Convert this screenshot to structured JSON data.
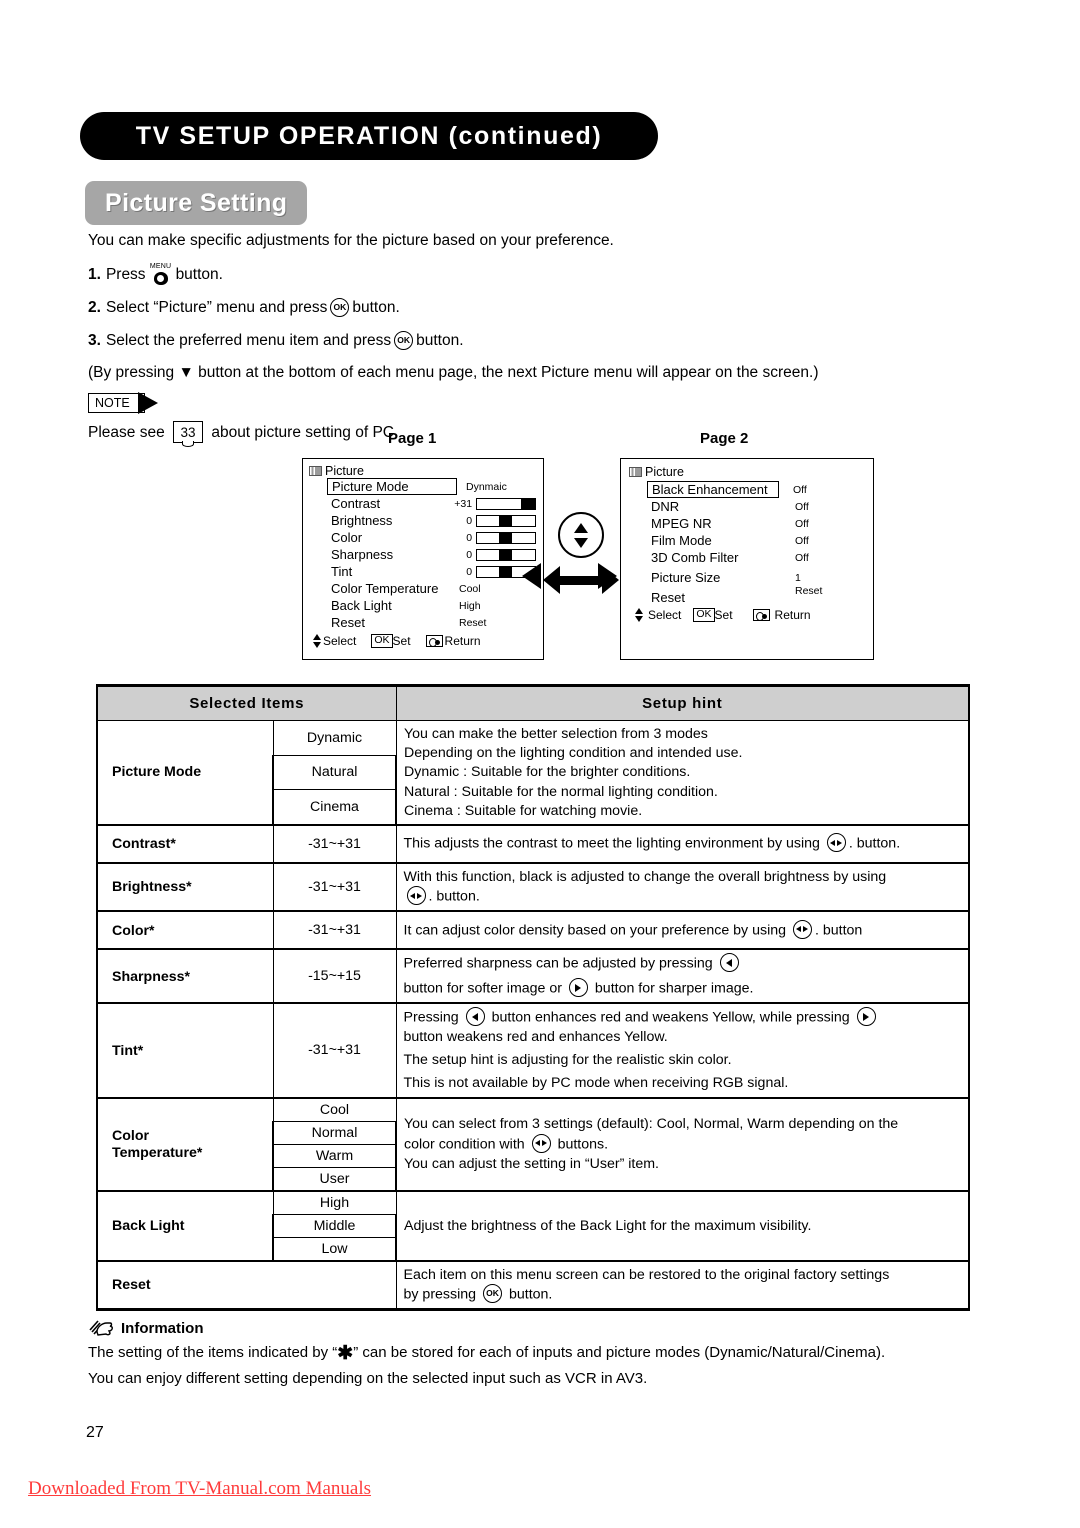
{
  "header": {
    "title": "TV SETUP OPERATION (continued)"
  },
  "section": {
    "title": "Picture Setting"
  },
  "intro": {
    "lead": "You can make specific adjustments for the picture based on your preference.",
    "steps": [
      {
        "num": "1.",
        "before": "Press",
        "icon": "menu-button",
        "after": "button."
      },
      {
        "num": "2.",
        "before": "Select “Picture” menu and press",
        "icon": "ok-button",
        "after": "button."
      },
      {
        "num": "3.",
        "before": "Select the preferred menu item and press",
        "icon": "ok-button",
        "after": "button."
      }
    ],
    "paren": "(By pressing ▼ button at the bottom of each menu page, the next Picture menu will appear on the screen.)",
    "note_badge": "NOTE",
    "note_before": "Please see",
    "note_page_ref": "33",
    "note_after": "about picture setting of PC"
  },
  "osd": {
    "page1": {
      "label": "Page 1",
      "menu_title": "Picture",
      "rows": [
        {
          "name": "Picture Mode",
          "value": "Dynmaic",
          "boxed": true,
          "bar": null
        },
        {
          "name": "Contrast",
          "value": "+31",
          "boxed": false,
          "bar": 100
        },
        {
          "name": "Brightness",
          "value": "0",
          "boxed": false,
          "bar": 50
        },
        {
          "name": "Color",
          "value": "0",
          "boxed": false,
          "bar": 50
        },
        {
          "name": "Sharpness",
          "value": "0",
          "boxed": false,
          "bar": 50
        },
        {
          "name": "Tint",
          "value": "0",
          "boxed": false,
          "bar": 50
        },
        {
          "name": "Color Temperature",
          "value": "Cool",
          "boxed": false,
          "bar": null
        },
        {
          "name": "Back Light",
          "value": "High",
          "boxed": false,
          "bar": null
        },
        {
          "name": "Reset",
          "value": "Reset",
          "boxed": false,
          "bar": null
        }
      ],
      "footer": {
        "select": "Select",
        "ok": "OK",
        "set": "Set",
        "return": "Return"
      }
    },
    "page2": {
      "label": "Page 2",
      "menu_title": "Picture",
      "rows": [
        {
          "name": "Black Enhancement",
          "value": "Off",
          "boxed": true
        },
        {
          "name": "DNR",
          "value": "Off",
          "boxed": false
        },
        {
          "name": "MPEG NR",
          "value": "Off",
          "boxed": false
        },
        {
          "name": "Film Mode",
          "value": "Off",
          "boxed": false
        },
        {
          "name": "3D Comb Filter",
          "value": "Off",
          "boxed": false
        },
        {
          "name": "Picture Size",
          "value": "1",
          "boxed": false
        },
        {
          "name": "Reset",
          "value": "Reset",
          "boxed": false
        }
      ],
      "footer": {
        "select": "Select",
        "ok": "OK",
        "set": "Set",
        "return": "Return"
      }
    }
  },
  "table": {
    "headers": {
      "items": "Selected Items",
      "hint": "Setup hint"
    },
    "rows": [
      {
        "item": "Picture Mode",
        "values": [
          "Dynamic",
          "Natural",
          "Cinema"
        ],
        "hint_lines": [
          "You can make the better selection from 3 modes",
          "Depending on the lighting condition and intended use.",
          "Dynamic : Suitable for the brighter conditions.",
          "Natural    : Suitable for the normal lighting condition.",
          "Cinema   : Suitable for watching movie."
        ]
      },
      {
        "item": "Contrast",
        "star": true,
        "values": [
          "-31~+31"
        ],
        "hint_parts": [
          "This adjusts the contrast to meet the lighting environment by using",
          "lr-button",
          ". button."
        ]
      },
      {
        "item": "Brightness",
        "star": true,
        "values": [
          "-31~+31"
        ],
        "hint_parts": [
          "With this function, black is adjusted to change the overall brightness by using",
          "lr-button",
          ". button."
        ]
      },
      {
        "item": "Color",
        "star": true,
        "values": [
          "-31~+31"
        ],
        "hint_parts": [
          "It can adjust color density based on your preference by using",
          "lr-button",
          ". button"
        ]
      },
      {
        "item": "Sharpness",
        "star": true,
        "values": [
          "-15~+15"
        ],
        "hint_parts_a": [
          "Preferred sharpness can be adjusted by pressing",
          "left-button",
          ""
        ],
        "hint_parts_b": [
          "button for softer image or",
          "right-button",
          "button for sharper image."
        ]
      },
      {
        "item": "Tint",
        "star": true,
        "values": [
          "-31~+31"
        ],
        "hint_parts_a": [
          "Pressing",
          "left-button",
          "button enhances red and weakens Yellow, while pressing",
          "right-button",
          ""
        ],
        "hint_b": "button weakens red and enhances Yellow.",
        "hint_c": "The setup hint is adjusting for the realistic skin color.",
        "hint_d": "This is not available by PC mode when receiving RGB signal."
      },
      {
        "item": "Color Temperature",
        "item_line1": "Color",
        "item_line2": "Temperature",
        "star": true,
        "values": [
          "Cool",
          "Normal",
          "Warm",
          "User"
        ],
        "hint_parts_a": [
          "You can select from 3 settings (default): Cool, Normal, Warm depending on the"
        ],
        "hint_parts_b": [
          "color condition with",
          "lr-button",
          "buttons."
        ],
        "hint_c": "You can adjust the setting in “User” item."
      },
      {
        "item": "Back Light",
        "values": [
          "High",
          "Middle",
          "Low"
        ],
        "hint_lines": [
          "Adjust the brightness of the Back Light for the maximum visibility."
        ]
      },
      {
        "item": "Reset",
        "values": [],
        "hint_parts_a": [
          "Each item on this menu screen can be restored to the original factory settings"
        ],
        "hint_parts_b": [
          "by pressing",
          "ok-button",
          "button."
        ]
      }
    ]
  },
  "information": {
    "heading": "Information",
    "line1_a": "The setting of the items indicated by “",
    "line1_star": "✱",
    "line1_b": "” can be stored for each of inputs and picture modes (Dynamic/Natural/Cinema).",
    "line2": "You can enjoy different setting depending on the selected input such as VCR in AV3."
  },
  "footer": {
    "page_number": "27",
    "watermark": "Downloaded From TV-Manual.com Manuals"
  }
}
